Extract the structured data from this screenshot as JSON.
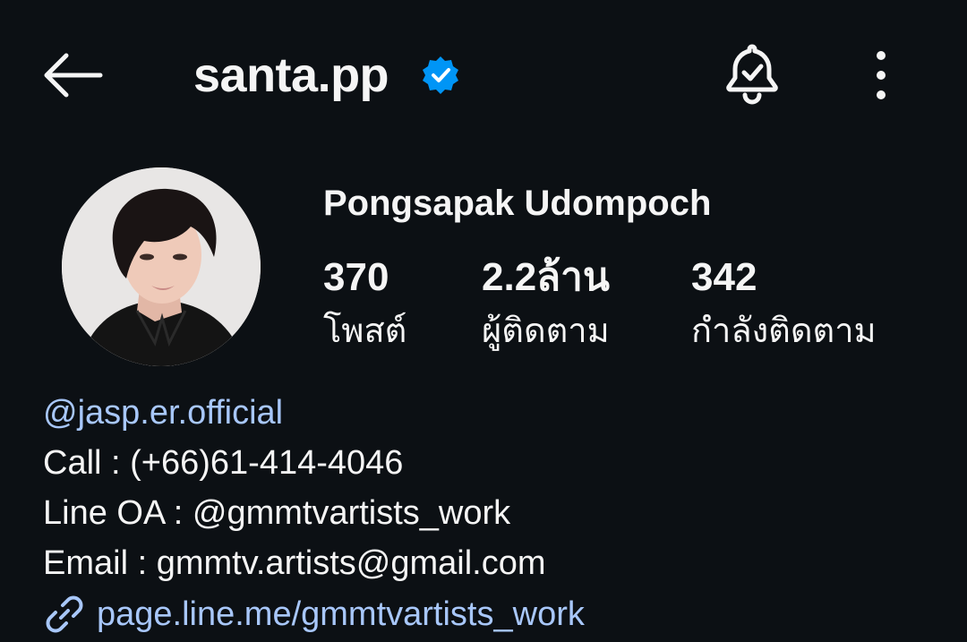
{
  "header": {
    "username": "santa.pp",
    "icons": {
      "back": "back-arrow-icon",
      "verified": "verified-badge-icon",
      "notifications": "bell-check-icon",
      "more": "more-vertical-icon"
    },
    "colors": {
      "background": "#0c1014",
      "verified": "#0095f6",
      "link": "#a8c7fa"
    }
  },
  "profile": {
    "full_name": "Pongsapak Udompoch",
    "stats": {
      "posts": {
        "value": "370",
        "label": "โพสต์"
      },
      "followers": {
        "value": "2.2ล้าน",
        "label": "ผู้ติดตาม"
      },
      "following": {
        "value": "342",
        "label": "กำลังติดตาม"
      }
    }
  },
  "bio": {
    "mention": "@jasp.er.official",
    "call": "Call : (+66)61-414-4046",
    "line_oa": "Line OA : @gmmtvartists_work",
    "email": "Email : gmmtv.artists@gmail.com",
    "link": "page.line.me/gmmtvartists_work",
    "link_icon": "link-icon"
  }
}
